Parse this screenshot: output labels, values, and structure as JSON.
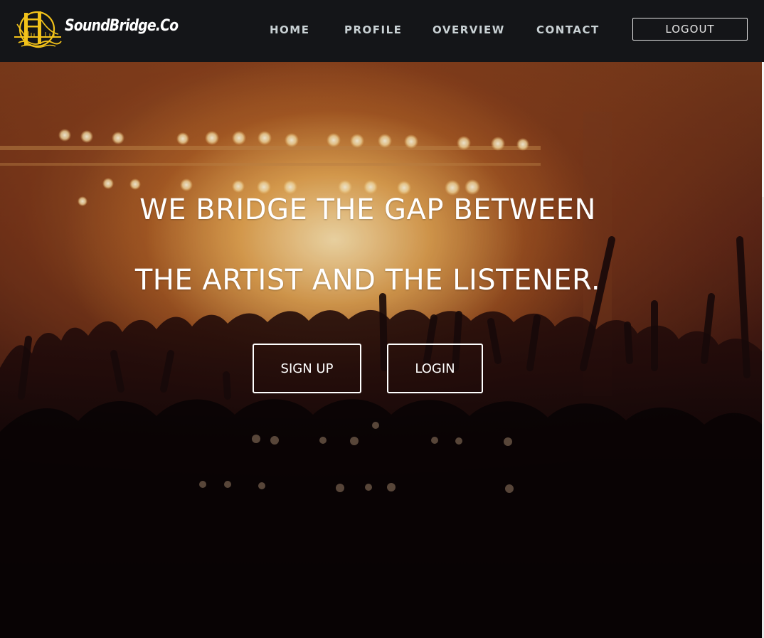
{
  "navbar": {
    "brand": "SoundBridge.Co",
    "logo_icon": "golden-gate-bridge-icon",
    "links": [
      {
        "label": "HOME"
      },
      {
        "label": "PROFILE"
      },
      {
        "label": "OVERVIEW"
      },
      {
        "label": "CONTACT"
      }
    ],
    "logout_label": "LOGOUT"
  },
  "hero": {
    "headline_line1": "WE BRIDGE THE GAP BETWEEN",
    "headline_line2": "THE ARTIST AND THE LISTENER.",
    "signup_label": "SIGN UP",
    "login_label": "LOGIN",
    "background": "concert-crowd-image"
  },
  "colors": {
    "navbar_bg": "#141518",
    "logo_gold": "#f2c21a",
    "nav_text": "#c9d1d4",
    "white": "#ffffff"
  }
}
